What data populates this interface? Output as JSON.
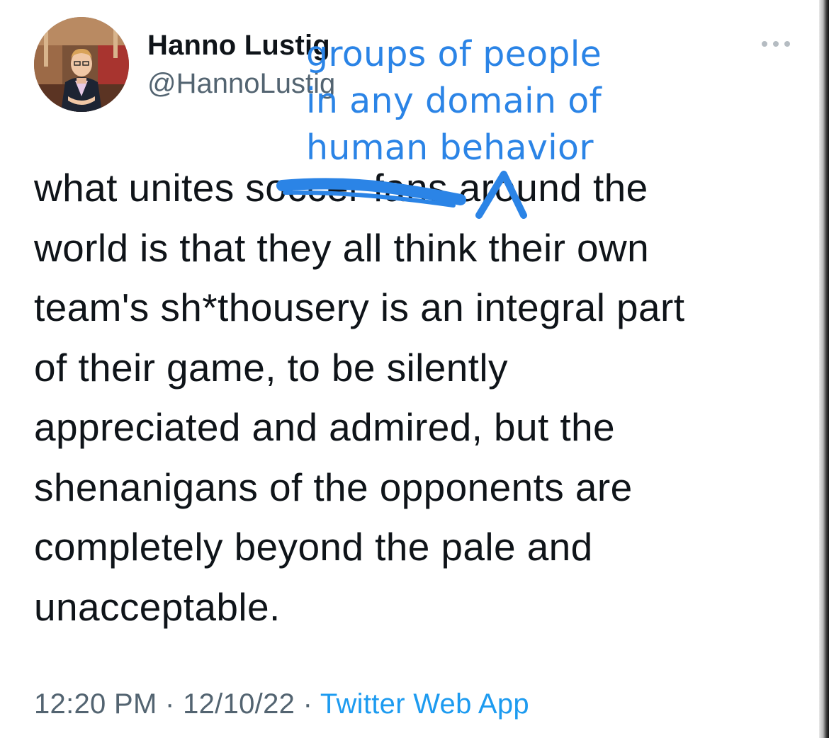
{
  "author": {
    "display_name": "Hanno Lustig",
    "handle": "@HannoLustig"
  },
  "icons": {
    "more": "more-options-icon",
    "avatar": "profile-photo"
  },
  "annotation": {
    "text": "groups of people\nin any domain of\nhuman behavior",
    "crossed_out": "soccer fans",
    "color": "#2b84e6"
  },
  "tweet": {
    "text": "what unites soccer fans around the\nworld is that they all think their own\nteam's sh*thousery is an integral part\nof their game, to be silently\nappreciated and admired, but the\nshenanigans of the opponents are\ncompletely beyond the pale and\nunacceptable."
  },
  "meta": {
    "time": "12:20 PM",
    "separator": " · ",
    "date": "12/10/22",
    "source": "Twitter Web App"
  },
  "colors": {
    "text": "#0f1419",
    "secondary": "#536471",
    "link": "#1d9bf0"
  }
}
